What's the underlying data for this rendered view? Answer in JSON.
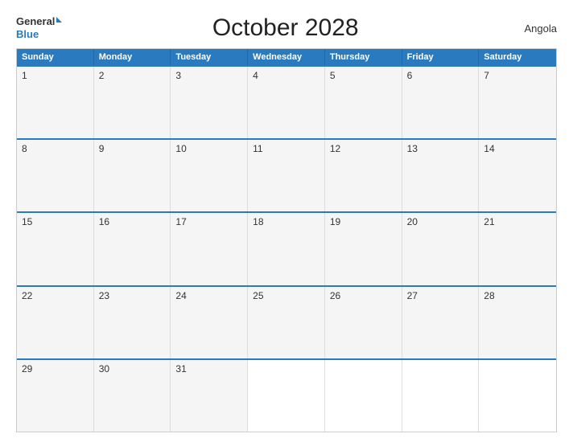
{
  "header": {
    "logo_general": "General",
    "logo_blue": "Blue",
    "title": "October 2028",
    "country": "Angola"
  },
  "calendar": {
    "days_of_week": [
      "Sunday",
      "Monday",
      "Tuesday",
      "Wednesday",
      "Thursday",
      "Friday",
      "Saturday"
    ],
    "weeks": [
      [
        {
          "day": "1"
        },
        {
          "day": "2"
        },
        {
          "day": "3"
        },
        {
          "day": "4"
        },
        {
          "day": "5"
        },
        {
          "day": "6"
        },
        {
          "day": "7"
        }
      ],
      [
        {
          "day": "8"
        },
        {
          "day": "9"
        },
        {
          "day": "10"
        },
        {
          "day": "11"
        },
        {
          "day": "12"
        },
        {
          "day": "13"
        },
        {
          "day": "14"
        }
      ],
      [
        {
          "day": "15"
        },
        {
          "day": "16"
        },
        {
          "day": "17"
        },
        {
          "day": "18"
        },
        {
          "day": "19"
        },
        {
          "day": "20"
        },
        {
          "day": "21"
        }
      ],
      [
        {
          "day": "22"
        },
        {
          "day": "23"
        },
        {
          "day": "24"
        },
        {
          "day": "25"
        },
        {
          "day": "26"
        },
        {
          "day": "27"
        },
        {
          "day": "28"
        }
      ],
      [
        {
          "day": "29"
        },
        {
          "day": "30"
        },
        {
          "day": "31"
        },
        {
          "day": ""
        },
        {
          "day": ""
        },
        {
          "day": ""
        },
        {
          "day": ""
        }
      ]
    ]
  },
  "colors": {
    "header_bg": "#2a7abf",
    "accent": "#2a7abf"
  }
}
